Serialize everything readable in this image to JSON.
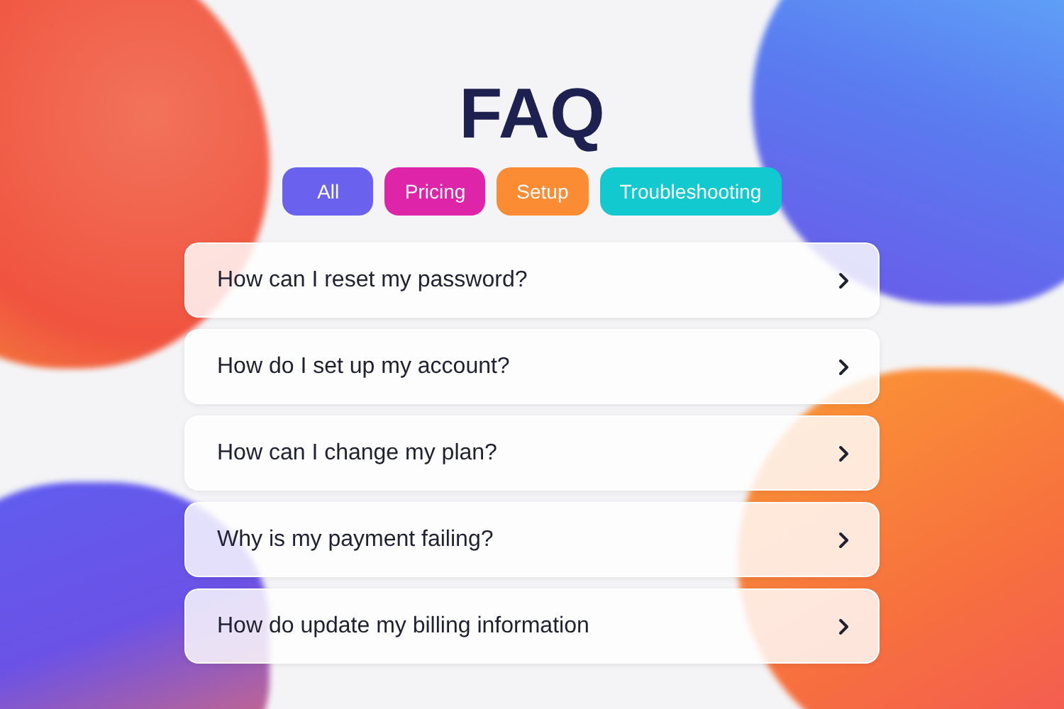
{
  "title": "FAQ",
  "categories": [
    {
      "label": "All",
      "color": "#6a62ee"
    },
    {
      "label": "Pricing",
      "color": "#de24a8"
    },
    {
      "label": "Setup",
      "color": "#fb8c34"
    },
    {
      "label": "Troubleshooting",
      "color": "#12c9cf"
    }
  ],
  "questions": [
    {
      "text": "How can I reset my password?"
    },
    {
      "text": "How do I set up my account?"
    },
    {
      "text": "How can I change my plan?"
    },
    {
      "text": "Why is my payment failing?"
    },
    {
      "text": "How do update my billing information"
    }
  ]
}
